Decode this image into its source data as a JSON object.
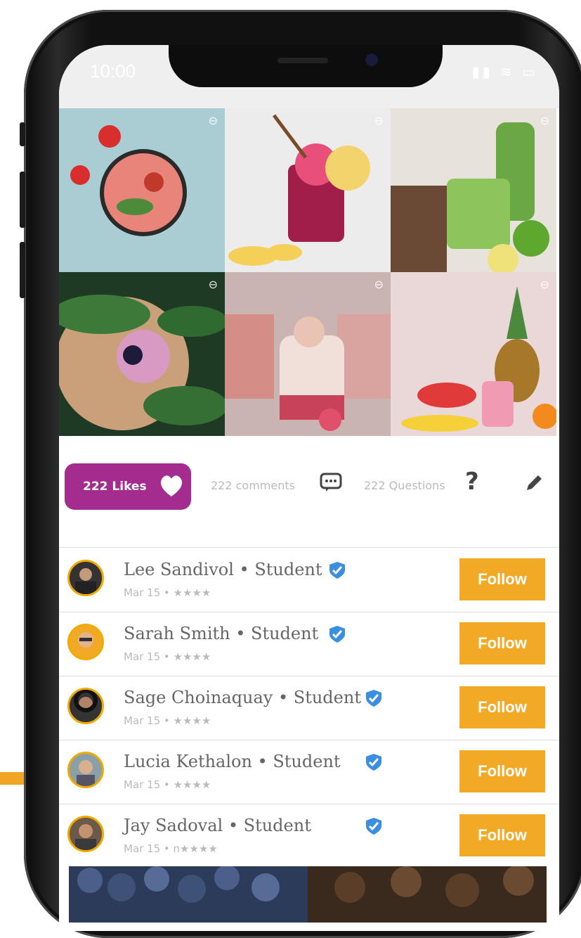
{
  "status_bar": {
    "time": "10:00"
  },
  "stats": {
    "likes_label": "222 Likes",
    "comments_label": "222 comments",
    "questions_label": "222 Questions"
  },
  "users": [
    {
      "name": "Lee Sandivol • Student",
      "meta": "Mar 15 • ★★★★"
    },
    {
      "name": "Sarah Smith • Student",
      "meta": "Mar 15 • ★★★★"
    },
    {
      "name": "Sage Choinaquay • Student",
      "meta": "Mar 15 • ★★★★"
    },
    {
      "name": "Lucia Kethalon • Student",
      "meta": "Mar 15 • ★★★★"
    },
    {
      "name": "Jay Sadoval • Student",
      "meta": "Mar 15 • n★★★★"
    }
  ],
  "follow_label": "Follow",
  "colors": {
    "likes": "#a52c8f",
    "follow": "#f2a926",
    "verified": "#3a8fe0"
  }
}
